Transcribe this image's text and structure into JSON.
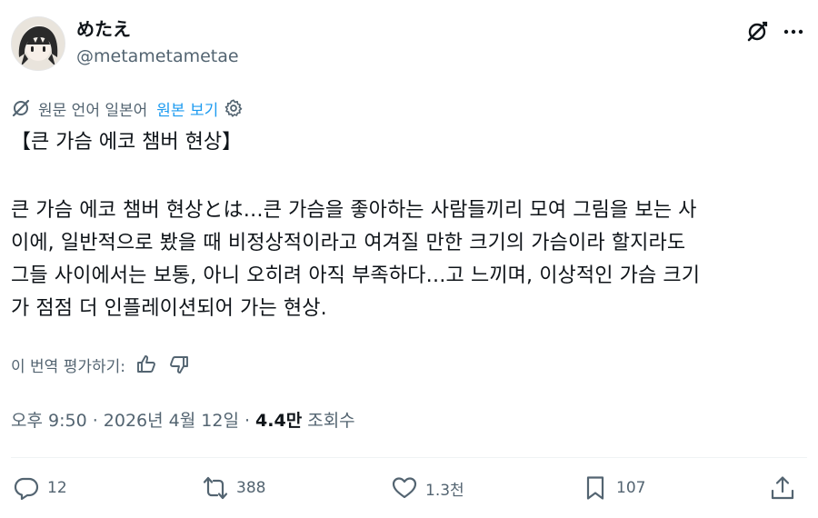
{
  "user": {
    "display_name": "めたえ",
    "handle": "@metametametae"
  },
  "translation": {
    "original_language_text": "원문 언어 일본어",
    "show_original_label": "원본 보기"
  },
  "post": {
    "title": "【큰 가슴 에코 챔버 현상】",
    "lines": [
      "큰 가슴 에코 챔버 현상とは…큰 가슴을 좋아하는 사람들끼리 모여 그림을 보는 사",
      "이에, 일반적으로 봤을 때 비정상적이라고 여겨질 만한 크기의 가슴이라 할지라도",
      "그들 사이에서는 보통, 아니 오히려 아직 부족하다…고 느끼며, 이상적인 가슴 크기",
      "가 점점 더 인플레이션되어 가는 현상."
    ]
  },
  "rate_translation": {
    "label": "이 번역 평가하기:"
  },
  "meta": {
    "time_date": "오후 9:50 · 2026년 4월 12일 · ",
    "views_count": "4.4만",
    "views_label": " 조회수"
  },
  "actions": {
    "replies": "12",
    "reposts": "388",
    "likes": "1.3천",
    "bookmarks": "107"
  },
  "icons": {
    "header": [
      "grok-icon",
      "more-icon"
    ],
    "translation": [
      "translate-icon",
      "gear-icon"
    ],
    "rating": [
      "thumbs-up-icon",
      "thumbs-down-icon"
    ],
    "actions": [
      "reply-icon",
      "repost-icon",
      "like-icon",
      "bookmark-icon",
      "share-icon"
    ]
  },
  "colors": {
    "text": "#0f1419",
    "secondary": "#536471",
    "accent": "#1d9bf0"
  }
}
